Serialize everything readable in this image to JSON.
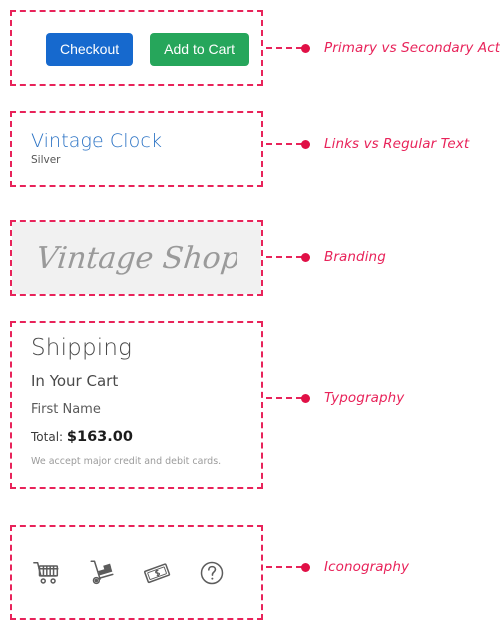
{
  "theme": {
    "annotation_color": "#e8235a",
    "annotation_dot_color": "#e01046",
    "primary_button_color": "#1669ce",
    "secondary_button_color": "#26a65b",
    "link_color": "#2a72c4",
    "branding_bg_color": "#f1f1f1",
    "branding_text_color": "#9a9a9a",
    "icon_color": "#5c5c5c"
  },
  "sections": {
    "actions": {
      "annotation": "Primary vs Secondary Actions",
      "primary_button": "Checkout",
      "secondary_button": "Add to Cart"
    },
    "links": {
      "annotation": "Links vs Regular Text",
      "link_text": "Vintage Clock",
      "regular_text": "Silver"
    },
    "branding": {
      "annotation": "Branding",
      "logo_text": "Vintage Shop"
    },
    "typography": {
      "annotation": "Typography",
      "heading": "Shipping",
      "subheading": "In Your Cart",
      "field_label": "First Name",
      "total_label": "Total:",
      "total_amount": "$163.00",
      "fine_print": "We accept major credit and debit cards."
    },
    "iconography": {
      "annotation": "Iconography",
      "icons": [
        {
          "name": "shopping-cart-icon",
          "label": "Shopping Cart"
        },
        {
          "name": "hand-truck-icon",
          "label": "Hand Truck"
        },
        {
          "name": "money-bill-icon",
          "label": "Money Bill"
        },
        {
          "name": "question-mark-circle-icon",
          "label": "Help"
        }
      ]
    }
  }
}
